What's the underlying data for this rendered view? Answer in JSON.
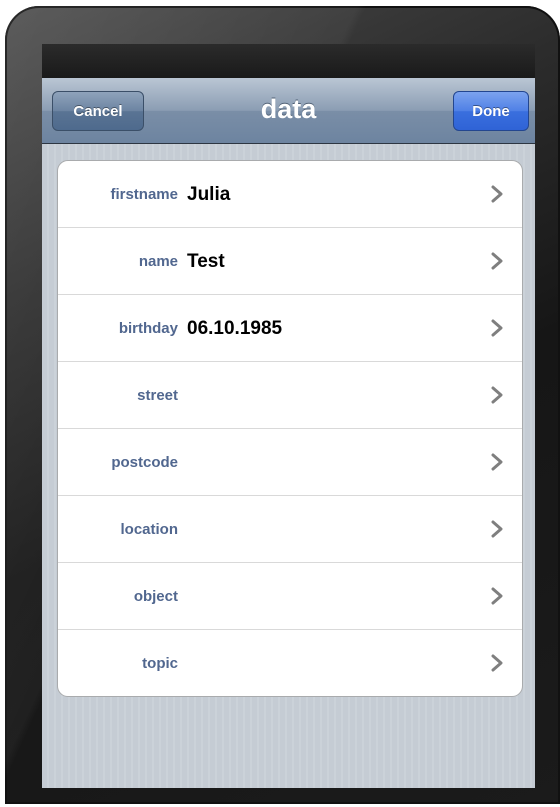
{
  "nav": {
    "title": "data",
    "cancel_label": "Cancel",
    "done_label": "Done"
  },
  "fields": [
    {
      "label": "firstname",
      "value": "Julia"
    },
    {
      "label": "name",
      "value": "Test"
    },
    {
      "label": "birthday",
      "value": "06.10.1985"
    },
    {
      "label": "street",
      "value": ""
    },
    {
      "label": "postcode",
      "value": ""
    },
    {
      "label": "location",
      "value": ""
    },
    {
      "label": "object",
      "value": ""
    },
    {
      "label": "topic",
      "value": ""
    }
  ],
  "icons": {
    "row_accessory": "chevron-right-icon"
  },
  "colors": {
    "label": "#51678f",
    "done_button": "#3a6fde",
    "nav_bar": "#7a8ea7"
  }
}
